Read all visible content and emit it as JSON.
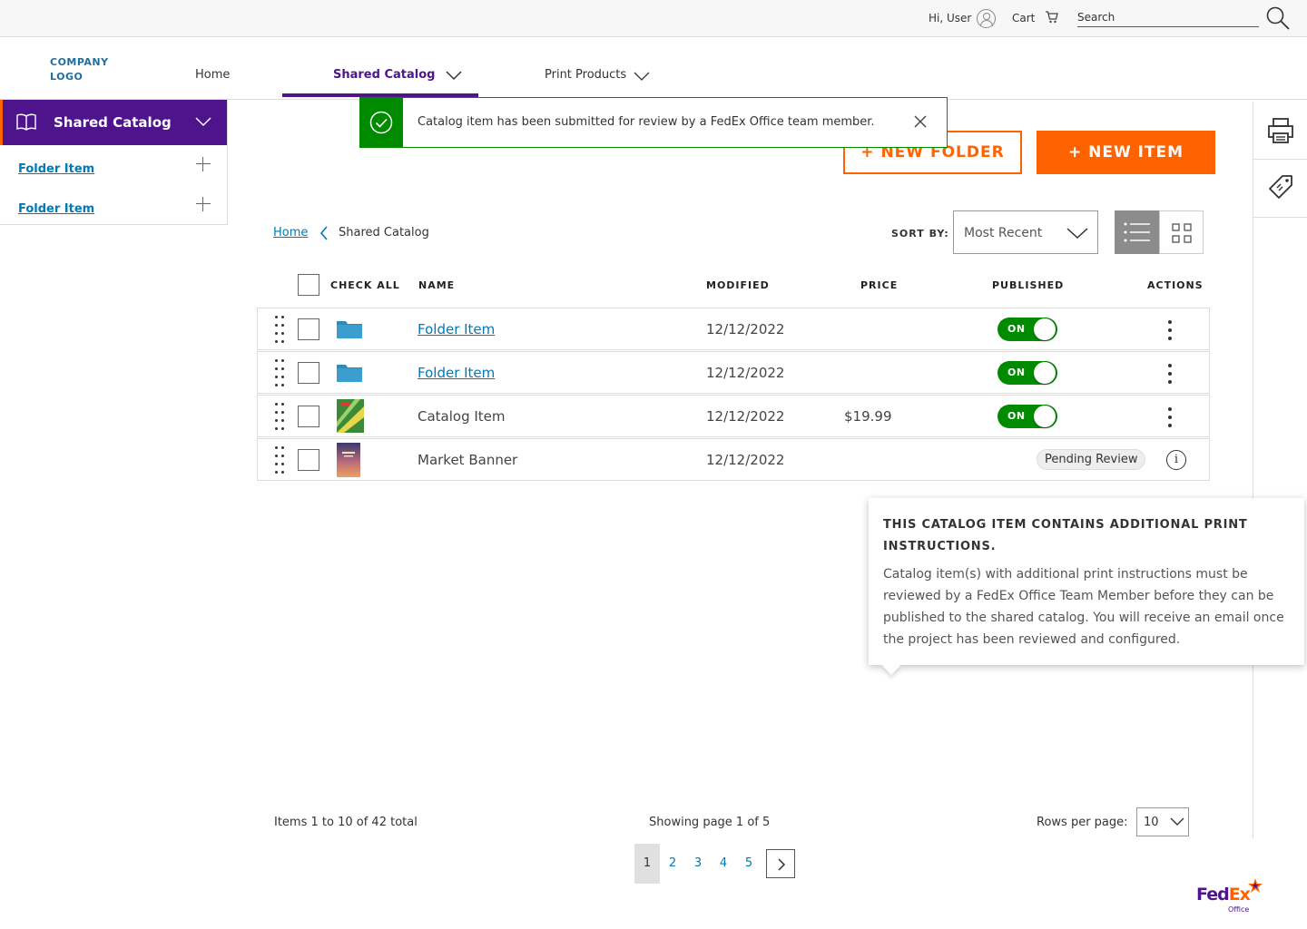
{
  "utility": {
    "greeting": "Hi, User",
    "cart_label": "Cart",
    "search_placeholder": "Search"
  },
  "header": {
    "logo_line1": "COMPANY",
    "logo_line2": "LOGO",
    "nav": {
      "home": "Home",
      "shared_catalog": "Shared Catalog",
      "print_products": "Print Products"
    }
  },
  "sidebar": {
    "title": "Shared Catalog",
    "items": [
      {
        "label": "Folder Item"
      },
      {
        "label": "Folder Item"
      }
    ]
  },
  "toast": {
    "message": "Catalog item has been submitted for review by a FedEx Office team member."
  },
  "actions": {
    "new_folder": "+ NEW FOLDER",
    "new_item": "+ NEW ITEM"
  },
  "breadcrumb": {
    "home": "Home",
    "current": "Shared Catalog"
  },
  "sort": {
    "label": "SORT BY:",
    "value": "Most Recent"
  },
  "table": {
    "headers": {
      "check_all": "CHECK ALL",
      "name": "NAME",
      "modified": "MODIFIED",
      "price": "PRICE",
      "published": "PUBLISHED",
      "actions": "ACTIONS"
    },
    "rows": [
      {
        "name": "Folder Item",
        "modified": "12/12/2022",
        "price": "",
        "published": "ON"
      },
      {
        "name": "Folder Item",
        "modified": "12/12/2022",
        "price": "",
        "published": "ON"
      },
      {
        "name": "Catalog Item",
        "modified": "12/12/2022",
        "price": "$19.99",
        "published": "ON"
      },
      {
        "name": "Market Banner",
        "modified": "12/12/2022",
        "price": "",
        "status": "Pending Review"
      }
    ]
  },
  "tooltip": {
    "title": "THIS CATALOG ITEM CONTAINS ADDITIONAL PRINT INSTRUCTIONS.",
    "body": "Catalog item(s) with additional print instructions must be reviewed by a FedEx Office Team Member before they can be published to the shared catalog. You will receive an email once the project has been reviewed and configured."
  },
  "pagination": {
    "items_text": "Items 1 to 10 of 42 total",
    "showing_text": "Showing page 1 of 5",
    "rows_label": "Rows per page:",
    "rows_value": "10",
    "pages": [
      "1",
      "2",
      "3",
      "4",
      "5"
    ]
  },
  "brand": {
    "fed": "Fed",
    "ex": "Ex",
    "office": "Office"
  },
  "colors": {
    "purple": "#4d148c",
    "orange": "#ff6200",
    "green": "#008a00",
    "link": "#007ab7"
  }
}
